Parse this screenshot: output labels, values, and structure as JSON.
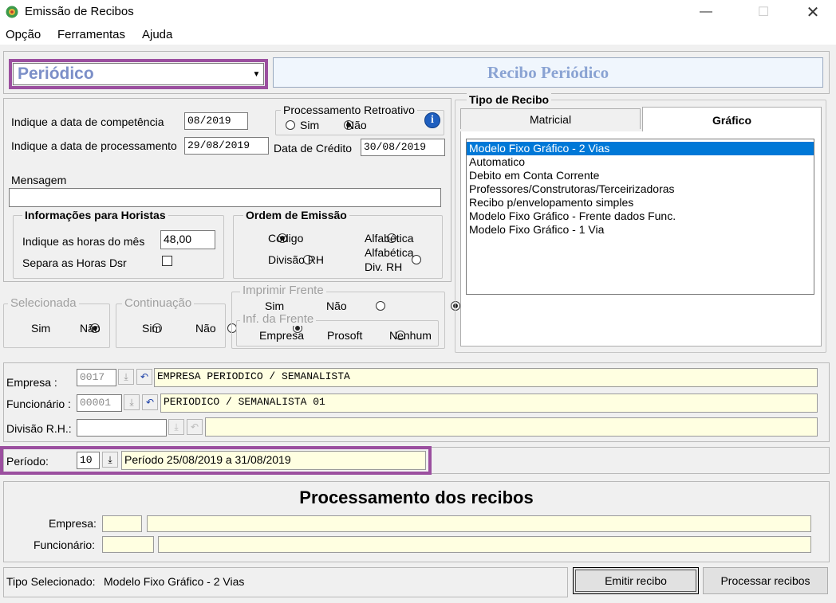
{
  "window": {
    "title": "Emissão de Recibos"
  },
  "menu": [
    "Opção",
    "Ferramentas",
    "Ajuda"
  ],
  "header": {
    "mode_value": "Periódico",
    "banner": "Recibo Periódico"
  },
  "dates": {
    "competencia_label": "Indique a data de competência",
    "competencia_value": "08/2019",
    "processamento_label": "Indique a data de processamento",
    "processamento_value": "29/08/2019",
    "credito_label": "Data de Crédito",
    "credito_value": "30/08/2019"
  },
  "retroativo": {
    "legend": "Processamento Retroativo",
    "sim": "Sim",
    "nao": "Não",
    "selected": "nao"
  },
  "mensagem": {
    "label": "Mensagem",
    "value": ""
  },
  "horistas": {
    "legend": "Informações para Horistas",
    "horas_label": "Indique as horas do mês",
    "horas_value": "48,00",
    "dsr_label": "Separa as Horas Dsr"
  },
  "ordem": {
    "legend": "Ordem de Emissão",
    "codigo": "Código",
    "alfabetica": "Alfabética",
    "divisao": "Divisão RH",
    "alfabetica_div_1": "Alfabética",
    "alfabetica_div_2": "Div.  RH",
    "selected": "codigo"
  },
  "selecionada": {
    "legend": "Selecionada",
    "sim": "Sim",
    "nao": "Não",
    "selected": "sim"
  },
  "continuacao": {
    "legend": "Continuação",
    "sim": "Sim",
    "nao": "Não",
    "selected": "nao"
  },
  "imprimir_frente": {
    "legend": "Imprimir Frente",
    "sim": "Sim",
    "nao": "Não",
    "selected": "nao"
  },
  "inf_frente": {
    "legend": "Inf. da Frente",
    "empresa": "Empresa",
    "prosoft": "Prosoft",
    "nenhum": "Nenhum",
    "selected": "nenhum"
  },
  "tipo_recibo": {
    "legend": "Tipo de Recibo",
    "tabs": [
      "Matricial",
      "Gráfico"
    ],
    "active_tab": "Gráfico",
    "items": [
      "Modelo Fixo Gráfico - 2 Vias",
      "Automatico",
      "Debito em Conta Corrente",
      "Professores/Construtoras/Terceirizadoras",
      "Recibo p/envelopamento simples",
      "Modelo Fixo Gráfico - Frente dados Func.",
      "Modelo Fixo Gráfico - 1 Via"
    ],
    "selected_index": 0
  },
  "selection": {
    "empresa_label": "Empresa :",
    "empresa_code": "0017",
    "empresa_name": "EMPRESA PERIODICO / SEMANALISTA",
    "funcionario_label": "Funcionário :",
    "funcionario_code": "00001",
    "funcionario_name": "PERIODICO / SEMANALISTA 01",
    "divisao_label": "Divisão R.H.:",
    "divisao_code": "",
    "divisao_name": "",
    "periodo_label": "Período:",
    "periodo_code": "10",
    "periodo_desc": "Período 25/08/2019 a 31/08/2019"
  },
  "processamento": {
    "title": "Processamento dos recibos",
    "empresa_label": "Empresa:",
    "funcionario_label": "Funcionário:"
  },
  "footer": {
    "tipo_label": "Tipo Selecionado:",
    "tipo_value": "Modelo Fixo Gráfico - 2 Vias",
    "emitir": "Emitir recibo",
    "processar": "Processar recibos"
  },
  "colors": {
    "highlight_border": "#9b4f9f",
    "selection_blue": "#0078d7",
    "yellow_field": "#ffffe1",
    "info_blue": "#1f5fbf"
  }
}
